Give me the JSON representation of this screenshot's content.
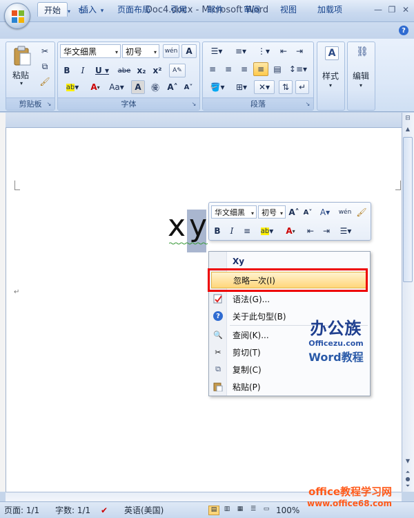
{
  "window": {
    "title": "Doc4.docx - Microsoft Word"
  },
  "tabs": [
    "开始",
    "插入",
    "页面布局",
    "引用",
    "邮件",
    "审阅",
    "视图",
    "加载项"
  ],
  "ribbon": {
    "clipboard": {
      "label": "剪贴板",
      "paste": "粘贴"
    },
    "font": {
      "label": "字体",
      "font_name": "华文细黑",
      "font_size": "初号"
    },
    "paragraph": {
      "label": "段落"
    },
    "styles": {
      "label": "样式"
    },
    "editing": {
      "label": "编辑"
    }
  },
  "document": {
    "text_x": "x",
    "text_y": "y"
  },
  "mini_toolbar": {
    "font_name": "华文细黑",
    "font_size": "初号"
  },
  "context_menu": {
    "items": [
      {
        "label": "Xy",
        "bold": true
      },
      {
        "label": "忽略一次(I)",
        "highlighted": true
      },
      {
        "label": "语法(G)..."
      },
      {
        "label": "关于此句型(B)"
      },
      {
        "label": "查阅(K)..."
      },
      {
        "label": "剪切(T)"
      },
      {
        "label": "复制(C)"
      },
      {
        "label": "粘贴(P)"
      }
    ]
  },
  "status_bar": {
    "page": "页面: 1/1",
    "words": "字数: 1/1",
    "language": "英语(美国)",
    "zoom": "100%"
  },
  "watermark": {
    "logo": "办公族",
    "site": "Officezu.com",
    "word": "Word教程",
    "line1": "office教程学习网",
    "line2": "www.office68.com"
  },
  "colors": {
    "accent": "#15428b",
    "highlight": "#ffd67a",
    "annotation": "#e00000"
  }
}
